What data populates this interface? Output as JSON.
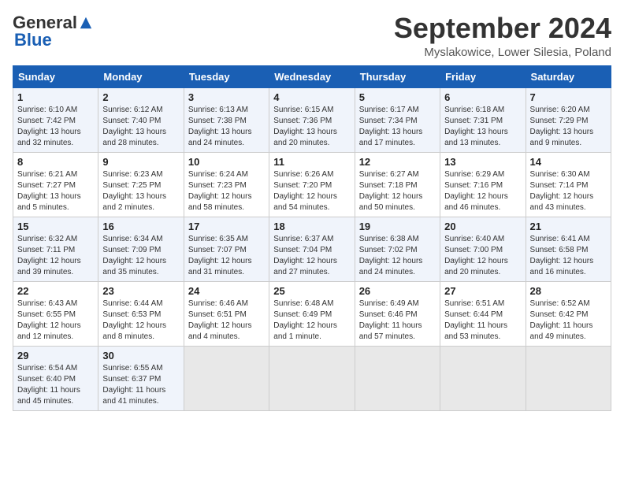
{
  "header": {
    "logo_general": "General",
    "logo_blue": "Blue",
    "month_title": "September 2024",
    "location": "Myslakowice, Lower Silesia, Poland"
  },
  "days_of_week": [
    "Sunday",
    "Monday",
    "Tuesday",
    "Wednesday",
    "Thursday",
    "Friday",
    "Saturday"
  ],
  "weeks": [
    [
      {
        "day": "1",
        "info": "Sunrise: 6:10 AM\nSunset: 7:42 PM\nDaylight: 13 hours\nand 32 minutes."
      },
      {
        "day": "2",
        "info": "Sunrise: 6:12 AM\nSunset: 7:40 PM\nDaylight: 13 hours\nand 28 minutes."
      },
      {
        "day": "3",
        "info": "Sunrise: 6:13 AM\nSunset: 7:38 PM\nDaylight: 13 hours\nand 24 minutes."
      },
      {
        "day": "4",
        "info": "Sunrise: 6:15 AM\nSunset: 7:36 PM\nDaylight: 13 hours\nand 20 minutes."
      },
      {
        "day": "5",
        "info": "Sunrise: 6:17 AM\nSunset: 7:34 PM\nDaylight: 13 hours\nand 17 minutes."
      },
      {
        "day": "6",
        "info": "Sunrise: 6:18 AM\nSunset: 7:31 PM\nDaylight: 13 hours\nand 13 minutes."
      },
      {
        "day": "7",
        "info": "Sunrise: 6:20 AM\nSunset: 7:29 PM\nDaylight: 13 hours\nand 9 minutes."
      }
    ],
    [
      {
        "day": "8",
        "info": "Sunrise: 6:21 AM\nSunset: 7:27 PM\nDaylight: 13 hours\nand 5 minutes."
      },
      {
        "day": "9",
        "info": "Sunrise: 6:23 AM\nSunset: 7:25 PM\nDaylight: 13 hours\nand 2 minutes."
      },
      {
        "day": "10",
        "info": "Sunrise: 6:24 AM\nSunset: 7:23 PM\nDaylight: 12 hours\nand 58 minutes."
      },
      {
        "day": "11",
        "info": "Sunrise: 6:26 AM\nSunset: 7:20 PM\nDaylight: 12 hours\nand 54 minutes."
      },
      {
        "day": "12",
        "info": "Sunrise: 6:27 AM\nSunset: 7:18 PM\nDaylight: 12 hours\nand 50 minutes."
      },
      {
        "day": "13",
        "info": "Sunrise: 6:29 AM\nSunset: 7:16 PM\nDaylight: 12 hours\nand 46 minutes."
      },
      {
        "day": "14",
        "info": "Sunrise: 6:30 AM\nSunset: 7:14 PM\nDaylight: 12 hours\nand 43 minutes."
      }
    ],
    [
      {
        "day": "15",
        "info": "Sunrise: 6:32 AM\nSunset: 7:11 PM\nDaylight: 12 hours\nand 39 minutes."
      },
      {
        "day": "16",
        "info": "Sunrise: 6:34 AM\nSunset: 7:09 PM\nDaylight: 12 hours\nand 35 minutes."
      },
      {
        "day": "17",
        "info": "Sunrise: 6:35 AM\nSunset: 7:07 PM\nDaylight: 12 hours\nand 31 minutes."
      },
      {
        "day": "18",
        "info": "Sunrise: 6:37 AM\nSunset: 7:04 PM\nDaylight: 12 hours\nand 27 minutes."
      },
      {
        "day": "19",
        "info": "Sunrise: 6:38 AM\nSunset: 7:02 PM\nDaylight: 12 hours\nand 24 minutes."
      },
      {
        "day": "20",
        "info": "Sunrise: 6:40 AM\nSunset: 7:00 PM\nDaylight: 12 hours\nand 20 minutes."
      },
      {
        "day": "21",
        "info": "Sunrise: 6:41 AM\nSunset: 6:58 PM\nDaylight: 12 hours\nand 16 minutes."
      }
    ],
    [
      {
        "day": "22",
        "info": "Sunrise: 6:43 AM\nSunset: 6:55 PM\nDaylight: 12 hours\nand 12 minutes."
      },
      {
        "day": "23",
        "info": "Sunrise: 6:44 AM\nSunset: 6:53 PM\nDaylight: 12 hours\nand 8 minutes."
      },
      {
        "day": "24",
        "info": "Sunrise: 6:46 AM\nSunset: 6:51 PM\nDaylight: 12 hours\nand 4 minutes."
      },
      {
        "day": "25",
        "info": "Sunrise: 6:48 AM\nSunset: 6:49 PM\nDaylight: 12 hours\nand 1 minute."
      },
      {
        "day": "26",
        "info": "Sunrise: 6:49 AM\nSunset: 6:46 PM\nDaylight: 11 hours\nand 57 minutes."
      },
      {
        "day": "27",
        "info": "Sunrise: 6:51 AM\nSunset: 6:44 PM\nDaylight: 11 hours\nand 53 minutes."
      },
      {
        "day": "28",
        "info": "Sunrise: 6:52 AM\nSunset: 6:42 PM\nDaylight: 11 hours\nand 49 minutes."
      }
    ],
    [
      {
        "day": "29",
        "info": "Sunrise: 6:54 AM\nSunset: 6:40 PM\nDaylight: 11 hours\nand 45 minutes."
      },
      {
        "day": "30",
        "info": "Sunrise: 6:55 AM\nSunset: 6:37 PM\nDaylight: 11 hours\nand 41 minutes."
      },
      {
        "day": "",
        "info": ""
      },
      {
        "day": "",
        "info": ""
      },
      {
        "day": "",
        "info": ""
      },
      {
        "day": "",
        "info": ""
      },
      {
        "day": "",
        "info": ""
      }
    ]
  ]
}
